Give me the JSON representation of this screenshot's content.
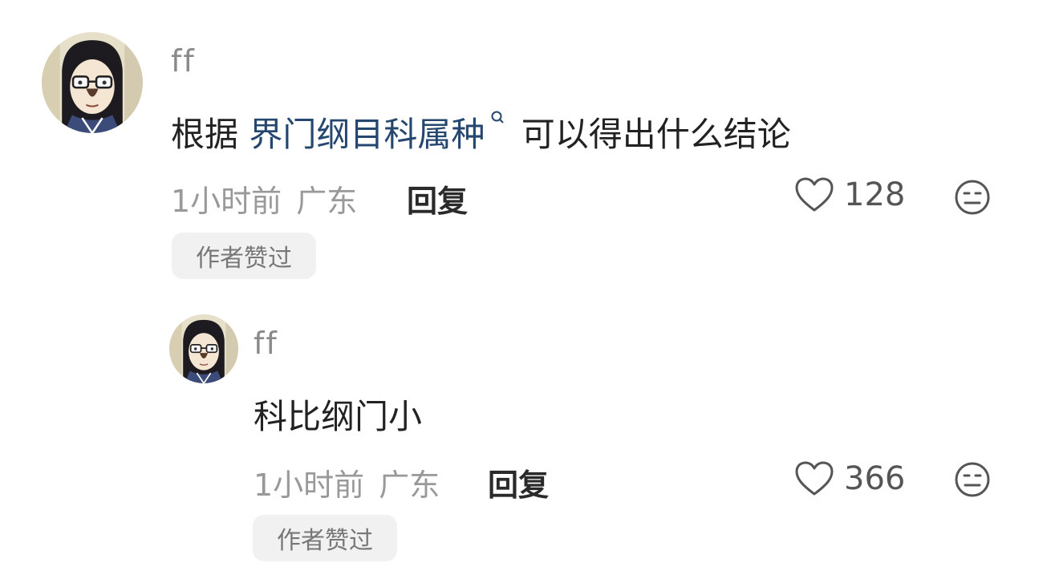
{
  "comments": [
    {
      "username": "ff",
      "text_prefix": "根据 ",
      "keyword": "界门纲目科属种",
      "text_suffix": " 可以得出什么结论",
      "time": "1小时前",
      "location": "广东",
      "reply_label": "回复",
      "like_count": "128",
      "author_tag": "作者赞过"
    },
    {
      "username": "ff",
      "text": "科比纲门小",
      "time": "1小时前",
      "location": "广东",
      "reply_label": "回复",
      "like_count": "366",
      "author_tag": "作者赞过"
    }
  ],
  "icons": {
    "like": "heart-outline-icon",
    "dislike": "expressionless-face-icon",
    "search": "search-icon"
  },
  "colors": {
    "keyword": "#24466f",
    "meta": "#999999",
    "tag_bg": "#f1f1f1"
  }
}
